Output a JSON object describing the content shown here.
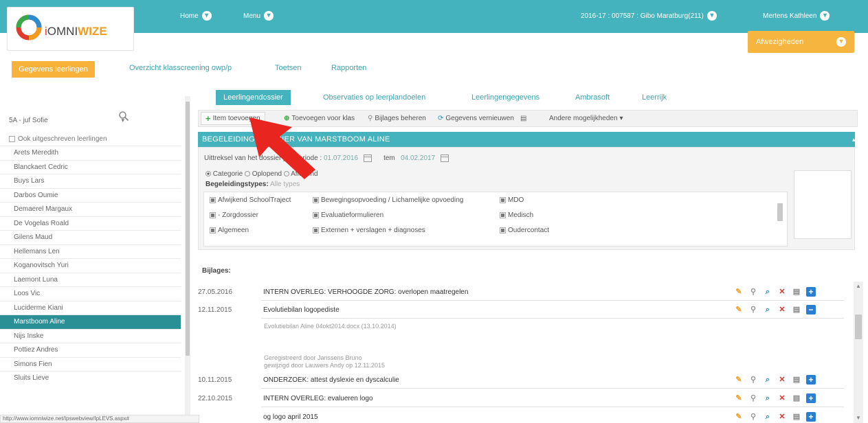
{
  "header": {
    "logo_text_prefix": "i",
    "logo_text_a": "OMNI",
    "logo_text_b": "WIZE",
    "nav_home": "Home",
    "nav_menu": "Menu",
    "nav_context": "2016-17 : 007587 : Gibo Maratburg(211)",
    "nav_user": "Mertens Kathleen",
    "alerts_label": "Afwezigheden"
  },
  "main_tabs": [
    {
      "label": "Gegevens leerlingen",
      "active": true
    },
    {
      "label": "Overzicht klasscreening owp/p",
      "active": false
    },
    {
      "label": "Toetsen",
      "active": false
    },
    {
      "label": "Rapporten",
      "active": false
    }
  ],
  "sidebar": {
    "class_value": "5A - juf Sofie",
    "include_unsubscribed": "Ook uitgeschreven leerlingen",
    "students": [
      {
        "name": "Arets Meredith",
        "selected": false
      },
      {
        "name": "Blanckaert Cedric",
        "selected": false
      },
      {
        "name": "Buys Lars",
        "selected": false
      },
      {
        "name": "Darbos Oumie",
        "selected": false
      },
      {
        "name": "Demaerel Margaux",
        "selected": false
      },
      {
        "name": "De Vogelas Roald",
        "selected": false
      },
      {
        "name": "Gilens Maud",
        "selected": false
      },
      {
        "name": "Hellemans Len",
        "selected": false
      },
      {
        "name": "Koganovitsch Yuri",
        "selected": false
      },
      {
        "name": "Laemont Luna",
        "selected": false
      },
      {
        "name": "Loos Vic",
        "selected": false
      },
      {
        "name": "Luciderme Kiani",
        "selected": false
      },
      {
        "name": "Marstboom Aline",
        "selected": true
      },
      {
        "name": "Nijs Inske",
        "selected": false
      },
      {
        "name": "Pottiez Andres",
        "selected": false
      },
      {
        "name": "Simons Fien",
        "selected": false
      },
      {
        "name": "Sluits Lieve",
        "selected": false
      }
    ]
  },
  "sub_tabs": [
    {
      "label": "Leerlingendossier",
      "active": true
    },
    {
      "label": "Observaties op leerplandoelen",
      "active": false
    },
    {
      "label": "Leerlingengegevens",
      "active": false
    },
    {
      "label": "Ambrasoft",
      "active": false
    },
    {
      "label": "Leerrijk",
      "active": false
    }
  ],
  "toolbar": {
    "add_item": "Item toevoegen",
    "add_class": "Toevoegen voor klas",
    "manage_attachments": "Bijlages beheren",
    "refresh": "Gegevens vernieuwen",
    "more": "Andere mogelijkheden"
  },
  "section": {
    "title": "BEGELEIDINGSDOSSIER VAN MARSTBOOM ALINE",
    "extract_label": "Uittreksel van het dossier per periode",
    "date_from": "01.07.2016",
    "date_to_label": "tem",
    "date_to": "04.02.2017",
    "radio_category": "Categorie",
    "radio_asc": "Oplopend",
    "radio_desc": "Aflopend",
    "types_label": "Begeleidingstypes:",
    "types_all": "Alle types",
    "types": [
      [
        "Afwijkend SchoolTraject",
        "Bewegingsopvoeding / Lichamelijke opvoeding",
        "MDO"
      ],
      [
        "- Zorgdossier",
        "Evaluatieformulieren",
        "Medisch"
      ],
      [
        "Algemeen",
        "Externen + verslagen + diagnoses",
        "Oudercontact"
      ]
    ]
  },
  "attachments": {
    "label": "Bijlages:",
    "rows": [
      {
        "date": "27.05.2016",
        "title": "INTERN OVERLEG: VERHOOGDE ZORG: overlopen maatregelen",
        "expanded": false
      },
      {
        "date": "12.11.2015",
        "title": "Evolutiebilan logopediste",
        "expanded": true,
        "detail_file": "Evolutiebilan Aline 04okt2014.docx (13.10.2014)",
        "detail_by": "Geregistreerd door Janssens Bruno",
        "detail_changed": "gewijzigd door Lauwers Andy op 12.11.2015"
      },
      {
        "date": "10.11.2015",
        "title": "ONDERZOEK: attest dyslexie en dyscalculie",
        "expanded": false
      },
      {
        "date": "22.10.2015",
        "title": "INTERN OVERLEG: evalueren logo",
        "expanded": false
      },
      {
        "date": "",
        "title": "og logo april 2015",
        "expanded": false
      }
    ]
  },
  "status_url": "http://www.iomniwize.net/Ipswebview/IpLEVS.aspx#",
  "colors": {
    "teal": "#44b3bd",
    "orange": "#f8b23a",
    "selected": "#2b8f96",
    "arrow": "#e8251f"
  }
}
